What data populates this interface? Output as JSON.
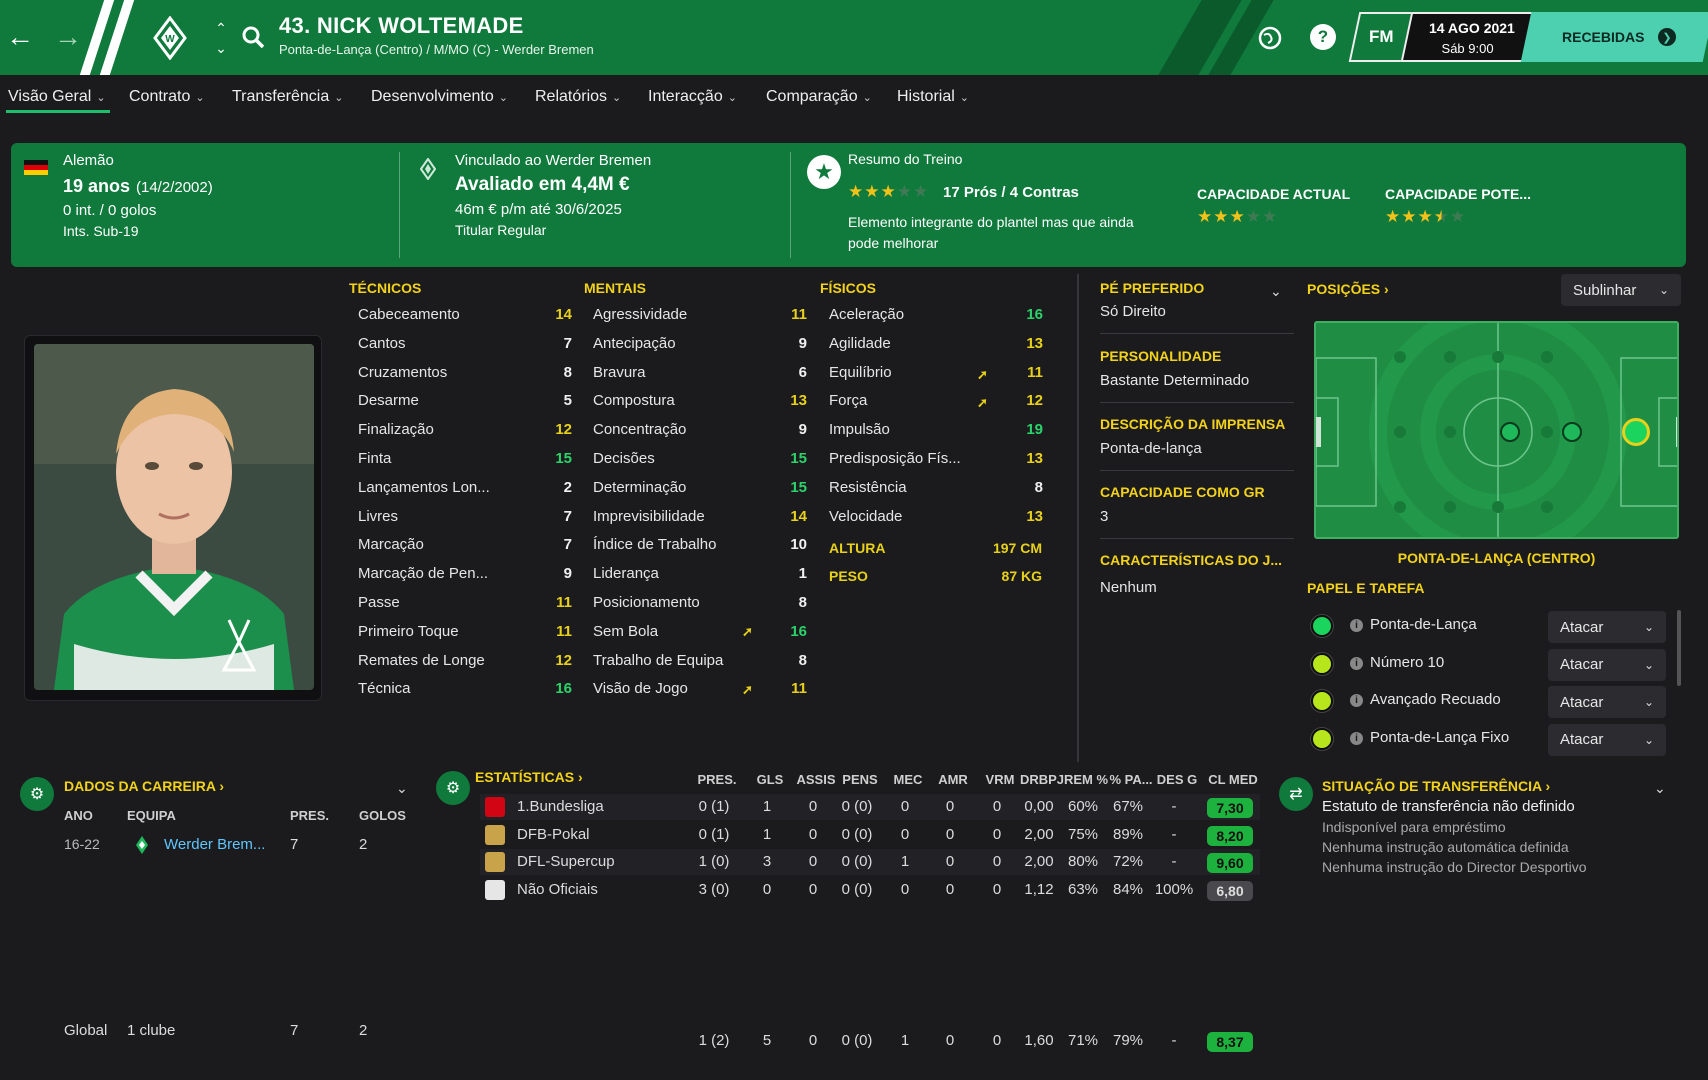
{
  "header": {
    "title": "43. NICK WOLTEMADE",
    "subtitle": "Ponta-de-Lança (Centro) / M/MO (C) - Werder Bremen",
    "fm_label": "FM",
    "date": "14 AGO 2021",
    "time": "Sáb 9:00",
    "inbox_label": "RECEBIDAS"
  },
  "nav": [
    "Visão Geral",
    "Contrato",
    "Transferência",
    "Desenvolvimento",
    "Relatórios",
    "Interacção",
    "Comparação",
    "Historial"
  ],
  "summary": {
    "nationality": "Alemão",
    "age": "19 anos",
    "dob": "(14/2/2002)",
    "caps": "0 int. / 0 golos",
    "youth": "Ints. Sub-19",
    "club_link": "Vinculado ao Werder Bremen",
    "value": "Avaliado em 4,4M €",
    "wage": "46m € p/m até 30/6/2025",
    "squad_status": "Titular Regular",
    "training_title": "Resumo do Treino",
    "pros_cons": "17 Prós / 4 Contras",
    "training_desc_1": "Elemento integrante do plantel mas que ainda",
    "training_desc_2": "pode melhorar",
    "training_stars": 3,
    "ca_label": "CAPACIDADE ACTUAL",
    "ca_stars": 3,
    "pa_label": "CAPACIDADE POTE...",
    "pa_stars": 3.5
  },
  "attributes": {
    "technical_title": "TÉCNICOS",
    "technical": [
      {
        "name": "Cabeceamento",
        "value": "14"
      },
      {
        "name": "Cantos",
        "value": "7"
      },
      {
        "name": "Cruzamentos",
        "value": "8"
      },
      {
        "name": "Desarme",
        "value": "5"
      },
      {
        "name": "Finalização",
        "value": "12"
      },
      {
        "name": "Finta",
        "value": "15"
      },
      {
        "name": "Lançamentos Lon...",
        "value": "2"
      },
      {
        "name": "Livres",
        "value": "7"
      },
      {
        "name": "Marcação",
        "value": "7"
      },
      {
        "name": "Marcação de Pen...",
        "value": "9"
      },
      {
        "name": "Passe",
        "value": "11"
      },
      {
        "name": "Primeiro Toque",
        "value": "11"
      },
      {
        "name": "Remates de Longe",
        "value": "12"
      },
      {
        "name": "Técnica",
        "value": "16"
      }
    ],
    "mental_title": "MENTAIS",
    "mental": [
      {
        "name": "Agressividade",
        "value": "11"
      },
      {
        "name": "Antecipação",
        "value": "9"
      },
      {
        "name": "Bravura",
        "value": "6"
      },
      {
        "name": "Compostura",
        "value": "13"
      },
      {
        "name": "Concentração",
        "value": "9"
      },
      {
        "name": "Decisões",
        "value": "15"
      },
      {
        "name": "Determinação",
        "value": "15"
      },
      {
        "name": "Imprevisibilidade",
        "value": "14"
      },
      {
        "name": "Índice de Trabalho",
        "value": "10"
      },
      {
        "name": "Liderança",
        "value": "1"
      },
      {
        "name": "Posicionamento",
        "value": "8"
      },
      {
        "name": "Sem Bola",
        "value": "16"
      },
      {
        "name": "Trabalho de Equipa",
        "value": "8"
      },
      {
        "name": "Visão de Jogo",
        "value": "11"
      }
    ],
    "physical_title": "FÍSICOS",
    "physical": [
      {
        "name": "Aceleração",
        "value": "16"
      },
      {
        "name": "Agilidade",
        "value": "13"
      },
      {
        "name": "Equilíbrio",
        "value": "11"
      },
      {
        "name": "Força",
        "value": "12"
      },
      {
        "name": "Impulsão",
        "value": "19"
      },
      {
        "name": "Predisposição Fís...",
        "value": "13"
      },
      {
        "name": "Resistência",
        "value": "8"
      },
      {
        "name": "Velocidade",
        "value": "13"
      }
    ],
    "height_label": "ALTURA",
    "height": "197 CM",
    "weight_label": "PESO",
    "weight": "87 KG"
  },
  "info": {
    "foot_label": "PÉ PREFERIDO",
    "foot": "Só Direito",
    "personality_label": "PERSONALIDADE",
    "personality": "Bastante Determinado",
    "media_label": "DESCRIÇÃO DA IMPRENSA",
    "media": "Ponta-de-lança",
    "gk_label": "CAPACIDADE COMO GR",
    "gk": "3",
    "traits_label": "CARACTERÍSTICAS DO J...",
    "traits": "Nenhum"
  },
  "positions": {
    "title": "POSIÇÕES",
    "highlight_select": "Sublinhar",
    "position_name": "PONTA-DE-LANÇA (CENTRO)",
    "role_title": "PAPEL E TAREFA",
    "roles": [
      {
        "name": "Ponta-de-Lança",
        "duty": "Atacar"
      },
      {
        "name": "Número 10",
        "duty": "Atacar"
      },
      {
        "name": "Avançado Recuado",
        "duty": "Atacar"
      },
      {
        "name": "Ponta-de-Lança Fixo",
        "duty": "Atacar"
      }
    ]
  },
  "career": {
    "title": "DADOS DA CARREIRA",
    "headers": [
      "ANO",
      "EQUIPA",
      "PRES.",
      "GOLOS"
    ],
    "rows": [
      {
        "year": "16-22",
        "team": "Werder Brem...",
        "apps": "7",
        "goals": "2"
      }
    ],
    "total": {
      "label": "Global",
      "clubs": "1 clube",
      "apps": "7",
      "goals": "2"
    }
  },
  "stats": {
    "title": "ESTATÍSTICAS",
    "headers": [
      "PRES.",
      "GLS",
      "ASSIS",
      "PENS",
      "MEC",
      "AMR",
      "VRM",
      "DRBPJ",
      "REM %",
      "% PA...",
      "DES G",
      "CL MED"
    ],
    "rows": [
      {
        "comp": "1.Bundesliga",
        "vals": [
          "0 (1)",
          "1",
          "0",
          "0 (0)",
          "0",
          "0",
          "0",
          "0,00",
          "60%",
          "67%",
          "-"
        ],
        "rating": "7,30"
      },
      {
        "comp": "DFB-Pokal",
        "vals": [
          "0 (1)",
          "1",
          "0",
          "0 (0)",
          "0",
          "0",
          "0",
          "2,00",
          "75%",
          "89%",
          "-"
        ],
        "rating": "8,20"
      },
      {
        "comp": "DFL-Supercup",
        "vals": [
          "1 (0)",
          "3",
          "0",
          "0 (0)",
          "1",
          "0",
          "0",
          "2,00",
          "80%",
          "72%",
          "-"
        ],
        "rating": "9,60"
      },
      {
        "comp": "Não Oficiais",
        "vals": [
          "3 (0)",
          "0",
          "0",
          "0 (0)",
          "0",
          "0",
          "0",
          "1,12",
          "63%",
          "84%",
          "100%"
        ],
        "rating": "6,80"
      }
    ],
    "total": {
      "vals": [
        "1 (2)",
        "5",
        "0",
        "0 (0)",
        "1",
        "0",
        "0",
        "1,60",
        "71%",
        "79%",
        "-"
      ],
      "rating": "8,37"
    }
  },
  "transfer": {
    "title": "SITUAÇÃO DE TRANSFERÊNCIA",
    "status": "Estatuto de transferência não definido",
    "loan": "Indisponível para empréstimo",
    "auto": "Nenhuma instrução automática definida",
    "dof": "Nenhuma instrução do Director Desportivo"
  },
  "colors": {
    "accent_green": "#0f7a3c",
    "attr_yellow": "#e8d11a",
    "attr_green": "#2bd36a",
    "inbox": "#4cd0b0"
  }
}
